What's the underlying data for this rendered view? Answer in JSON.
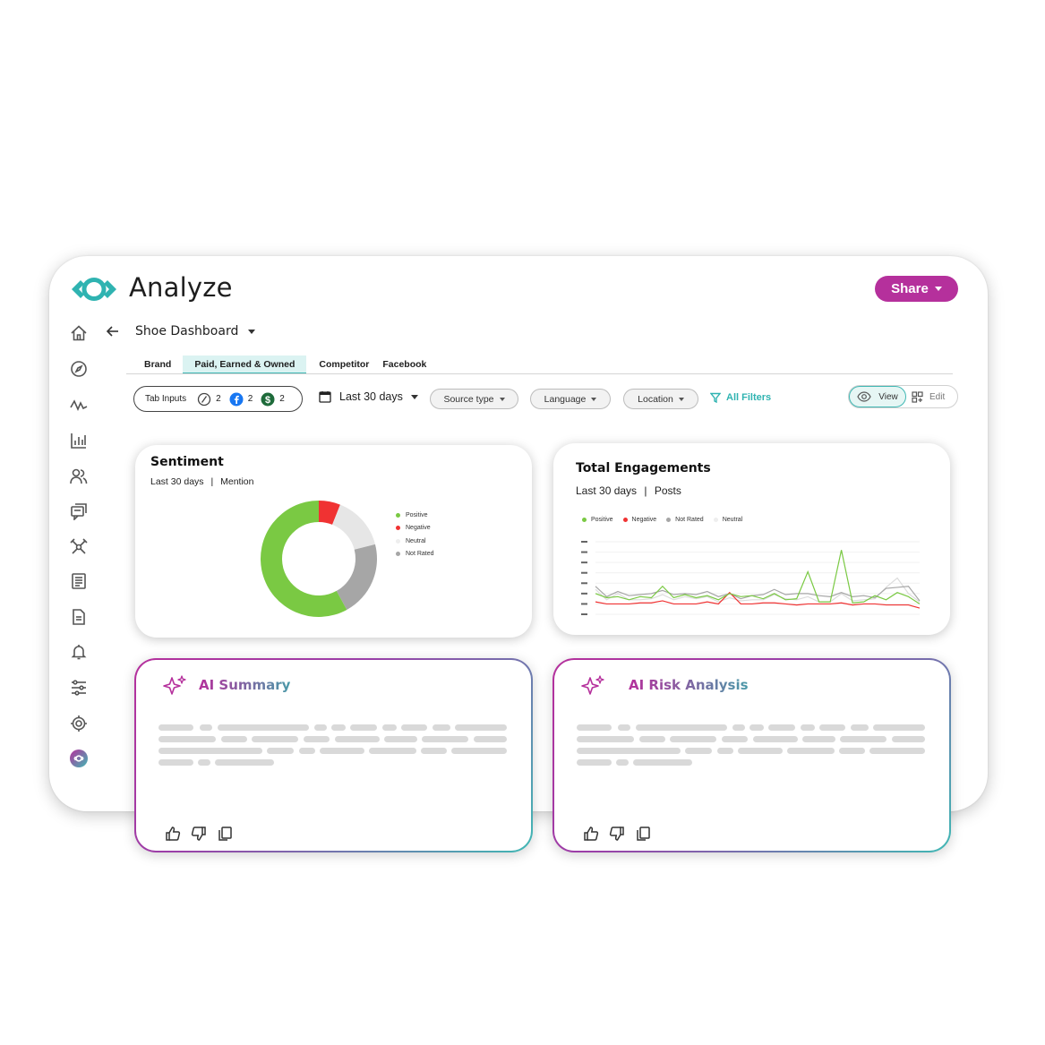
{
  "app": {
    "title": "Analyze",
    "share_label": "Share",
    "logo": "analyze-eye-logo"
  },
  "colors": {
    "brand_magenta": "#b5309c",
    "brand_teal": "#40b8b4",
    "positive": "#7ac943",
    "negative": "#f03232",
    "neutral": "#e6e6e6",
    "not_rated": "#a6a6a6"
  },
  "sidebar": {
    "items": [
      {
        "icon": "home-icon"
      },
      {
        "icon": "compass-icon"
      },
      {
        "icon": "activity-icon"
      },
      {
        "icon": "bar-chart-icon"
      },
      {
        "icon": "people-icon"
      },
      {
        "icon": "chat-icon"
      },
      {
        "icon": "network-icon"
      },
      {
        "icon": "report-icon"
      },
      {
        "icon": "document-icon"
      },
      {
        "icon": "bell-icon"
      },
      {
        "icon": "sliders-icon"
      },
      {
        "icon": "settings-icon"
      },
      {
        "icon": "analyze-logo-icon"
      }
    ]
  },
  "dashboard": {
    "title": "Shoe Dashboard"
  },
  "tabs": [
    {
      "label": "Brand"
    },
    {
      "label": "Paid, Earned & Owned"
    },
    {
      "label": "Competitor"
    },
    {
      "label": "Facebook"
    }
  ],
  "filters": {
    "tab_inputs_label": "Tab Inputs",
    "tab_inputs_counts": [
      "2",
      "2",
      "2"
    ],
    "date_range": "Last 30 days",
    "source_type": "Source type",
    "language": "Language",
    "location": "Location",
    "all_filters": "All Filters",
    "view_label": "View",
    "edit_label": "Edit"
  },
  "sentiment_card": {
    "title": "Sentiment",
    "period": "Last 30 days",
    "metric": "Mention",
    "legend": [
      "Positive",
      "Negative",
      "Neutral",
      "Not Rated"
    ]
  },
  "engagement_card": {
    "title": "Total Engagements",
    "period": "Last 30 days",
    "metric": "Posts",
    "legend": [
      "Positive",
      "Negative",
      "Not Rated",
      "Neutral"
    ]
  },
  "ai_summary": {
    "title": "AI Summary"
  },
  "ai_risk": {
    "title": "AI Risk Analysis"
  },
  "chart_data": [
    {
      "type": "pie",
      "title": "Sentiment",
      "categories": [
        "Positive",
        "Negative",
        "Neutral",
        "Not Rated"
      ],
      "values": [
        58,
        6,
        15,
        21
      ],
      "legend": "right"
    },
    {
      "type": "line",
      "title": "Total Engagements",
      "x": [
        1,
        2,
        3,
        4,
        5,
        6,
        7,
        8,
        9,
        10,
        11,
        12,
        13,
        14,
        15,
        16,
        17,
        18,
        19,
        20,
        21,
        22,
        23,
        24,
        25,
        26,
        27,
        28,
        29,
        30
      ],
      "series": [
        {
          "name": "Positive",
          "values": [
            20,
            16,
            17,
            14,
            17,
            16,
            27,
            16,
            19,
            16,
            18,
            14,
            20,
            17,
            18,
            15,
            20,
            14,
            15,
            41,
            12,
            12,
            62,
            11,
            12,
            18,
            14,
            21,
            17,
            10
          ]
        },
        {
          "name": "Negative",
          "values": [
            12,
            10,
            10,
            10,
            11,
            11,
            13,
            10,
            10,
            10,
            12,
            10,
            21,
            10,
            10,
            11,
            11,
            10,
            9,
            10,
            10,
            10,
            11,
            9,
            10,
            10,
            9,
            9,
            9,
            6
          ]
        },
        {
          "name": "Not Rated",
          "values": [
            27,
            17,
            22,
            18,
            19,
            20,
            23,
            19,
            20,
            19,
            22,
            17,
            20,
            15,
            18,
            19,
            24,
            19,
            20,
            20,
            18,
            17,
            21,
            17,
            18,
            16,
            25,
            26,
            27,
            13
          ]
        },
        {
          "name": "Neutral",
          "values": [
            24,
            14,
            20,
            14,
            14,
            15,
            19,
            14,
            17,
            15,
            17,
            12,
            16,
            13,
            14,
            14,
            19,
            15,
            14,
            17,
            12,
            12,
            20,
            13,
            14,
            15,
            26,
            35,
            20,
            12
          ]
        }
      ],
      "legend": "top-left",
      "grid": true
    }
  ]
}
